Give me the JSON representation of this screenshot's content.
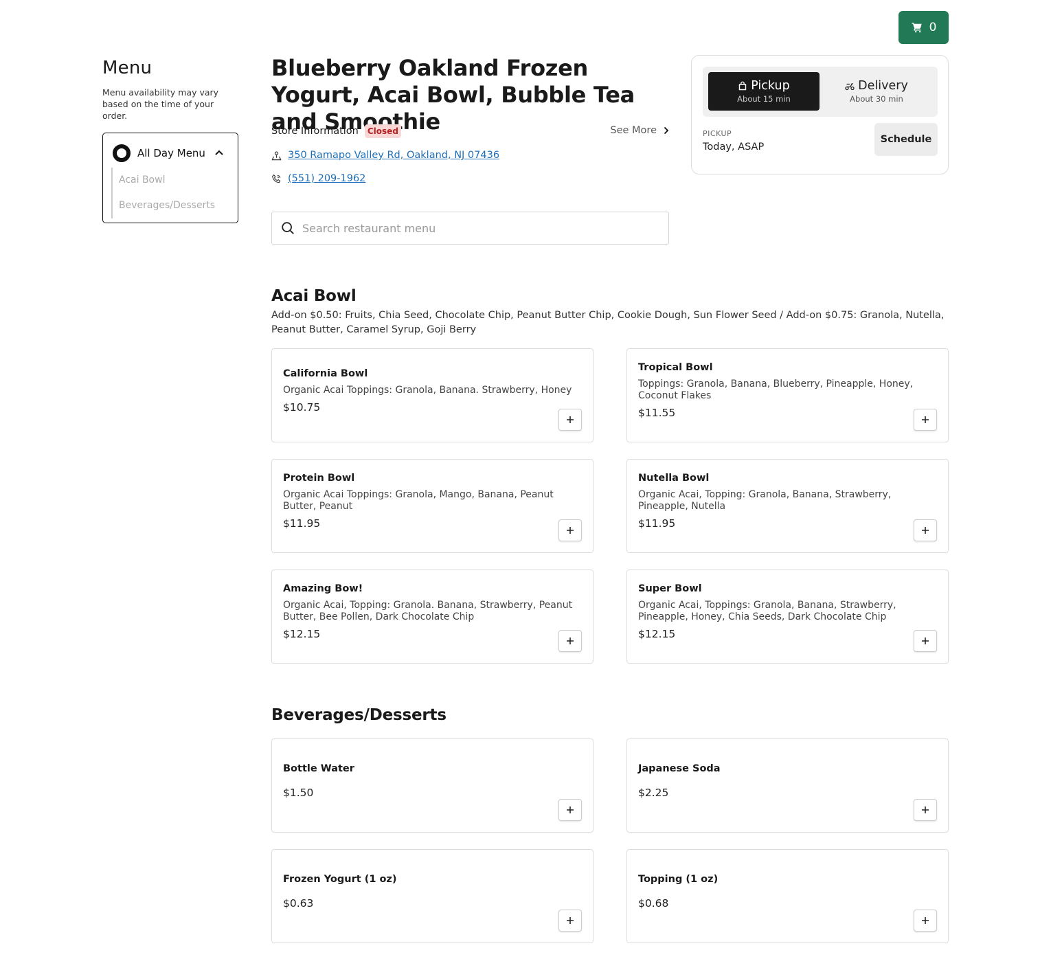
{
  "cart": {
    "count": "0",
    "icon": "cart-icon"
  },
  "sidebar": {
    "title": "Menu",
    "note": "Menu availability may vary based on the time of your order.",
    "menu_name": "All Day Menu",
    "items": [
      {
        "label": "Acai Bowl"
      },
      {
        "label": "Beverages/Desserts"
      }
    ]
  },
  "store": {
    "name": "Blueberry Oakland Frozen Yogurt, Acai Bowl, Bubble Tea and Smoothie",
    "info_label": "Store Information",
    "status": "Closed",
    "see_more": "See More",
    "address": "350 Ramapo Valley Rd, Oakland, NJ 07436",
    "phone": "(551) 209-1962"
  },
  "search": {
    "placeholder": "Search restaurant menu"
  },
  "order": {
    "pickup": {
      "label": "Pickup",
      "sub": "About 15 min"
    },
    "delivery": {
      "label": "Delivery",
      "sub": "About 30 min"
    },
    "mode_label": "PICKUP",
    "time_value": "Today, ASAP",
    "schedule_label": "Schedule"
  },
  "sections": [
    {
      "title": "Acai Bowl",
      "description": "Add-on $0.50: Fruits, Chia Seed, Chocolate Chip, Peanut Butter Chip, Cookie Dough, Sun Flower Seed / Add-on $0.75: Granola, Nutella, Peanut Butter, Caramel Syrup, Goji Berry",
      "items": [
        {
          "name": "California Bowl",
          "desc": "Organic Acai Toppings: Granola, Banana. Strawberry, Honey",
          "price": "$10.75"
        },
        {
          "name": "Tropical Bowl",
          "desc": "Toppings: Granola, Banana, Blueberry, Pineapple, Honey, Coconut Flakes",
          "price": "$11.55"
        },
        {
          "name": "Protein Bowl",
          "desc": "Organic Acai Toppings: Granola, Mango, Banana, Peanut Butter, Peanut",
          "price": "$11.95"
        },
        {
          "name": "Nutella Bowl",
          "desc": "Organic Acai, Topping: Granola, Banana, Strawberry, Pineapple, Nutella",
          "price": "$11.95"
        },
        {
          "name": "Amazing Bow!",
          "desc": "Organic Acai, Topping: Granola. Banana, Strawberry, Peanut Butter, Bee Pollen, Dark Chocolate Chip",
          "price": "$12.15"
        },
        {
          "name": "Super Bowl",
          "desc": "Organic Acai, Toppings: Granola, Banana, Strawberry, Pineapple, Honey, Chia Seeds, Dark Chocolate Chip",
          "price": "$12.15"
        }
      ]
    },
    {
      "title": "Beverages/Desserts",
      "items": [
        {
          "name": "Bottle Water",
          "price": "$1.50"
        },
        {
          "name": "Japanese Soda",
          "price": "$2.25"
        },
        {
          "name": "Frozen Yogurt (1 oz)",
          "price": "$0.63"
        },
        {
          "name": "Topping (1 oz)",
          "price": "$0.68"
        }
      ]
    }
  ],
  "colors": {
    "accent": "#217a55",
    "link": "#1f6fb8",
    "closed_bg": "#f9d7d7",
    "closed_text": "#b42323"
  }
}
